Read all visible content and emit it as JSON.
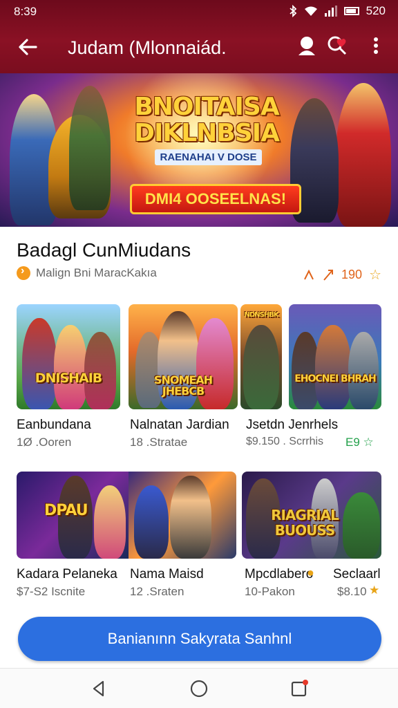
{
  "status_bar": {
    "time": "8:39",
    "battery": "520"
  },
  "app_bar": {
    "title": "Judam (Mlonnaiád.",
    "icons": [
      "back-arrow-icon",
      "profile-icon",
      "heart-icon",
      "more-vert-icon"
    ]
  },
  "banner": {
    "title": "BNOITAISA DIKLNBSIA",
    "subtitle": "RAENAHAI V DOSE",
    "cta": "DMI4 OOSEELNAS!"
  },
  "section": {
    "title": "Badagl CunMiudans",
    "meta": "Malign Bni MaracKakıa",
    "rating": "190"
  },
  "cards_row1": [
    {
      "logo": "DNISHAIB",
      "title": "Eanbundana",
      "subtitle": "1Ø .Ooren"
    },
    {
      "logo": "SNOMEAH JHEBCB",
      "title": "Nalnatan Jardian",
      "subtitle": "18 .Stratae"
    },
    {
      "logo": "NDNSHBK",
      "title": "Jsetdn Jenrhels",
      "subtitle": "$9.150 . Scrrhis",
      "rating": "E9"
    },
    {
      "logo": "EHOCNEI BHRAH",
      "title": "",
      "subtitle": ""
    }
  ],
  "cards_row2": [
    {
      "logo": "DPAU",
      "title": "Kadara Pelaneka",
      "subtitle": "$7-S2 Iscnite"
    },
    {
      "logo": "",
      "title": "Nama Maisd",
      "subtitle": "12 .Sraten"
    },
    {
      "logo": "RIAGRIAL BUOUSS",
      "title": "Mpcdlabero",
      "subtitle": "10-Pakon"
    },
    {
      "logo": "",
      "title": "Seclaarl",
      "subtitle": "$8.10"
    }
  ],
  "bottom_button": {
    "label": "Banianınn Sakyrata Sanhnl"
  },
  "nav": {
    "icons": [
      "nav-back-icon",
      "nav-home-icon",
      "nav-recents-icon"
    ]
  },
  "colors": {
    "appbar": "#7a0d1f",
    "primary_button": "#2c6fe0",
    "accent_orange": "#e0641b",
    "green": "#22a04a"
  }
}
